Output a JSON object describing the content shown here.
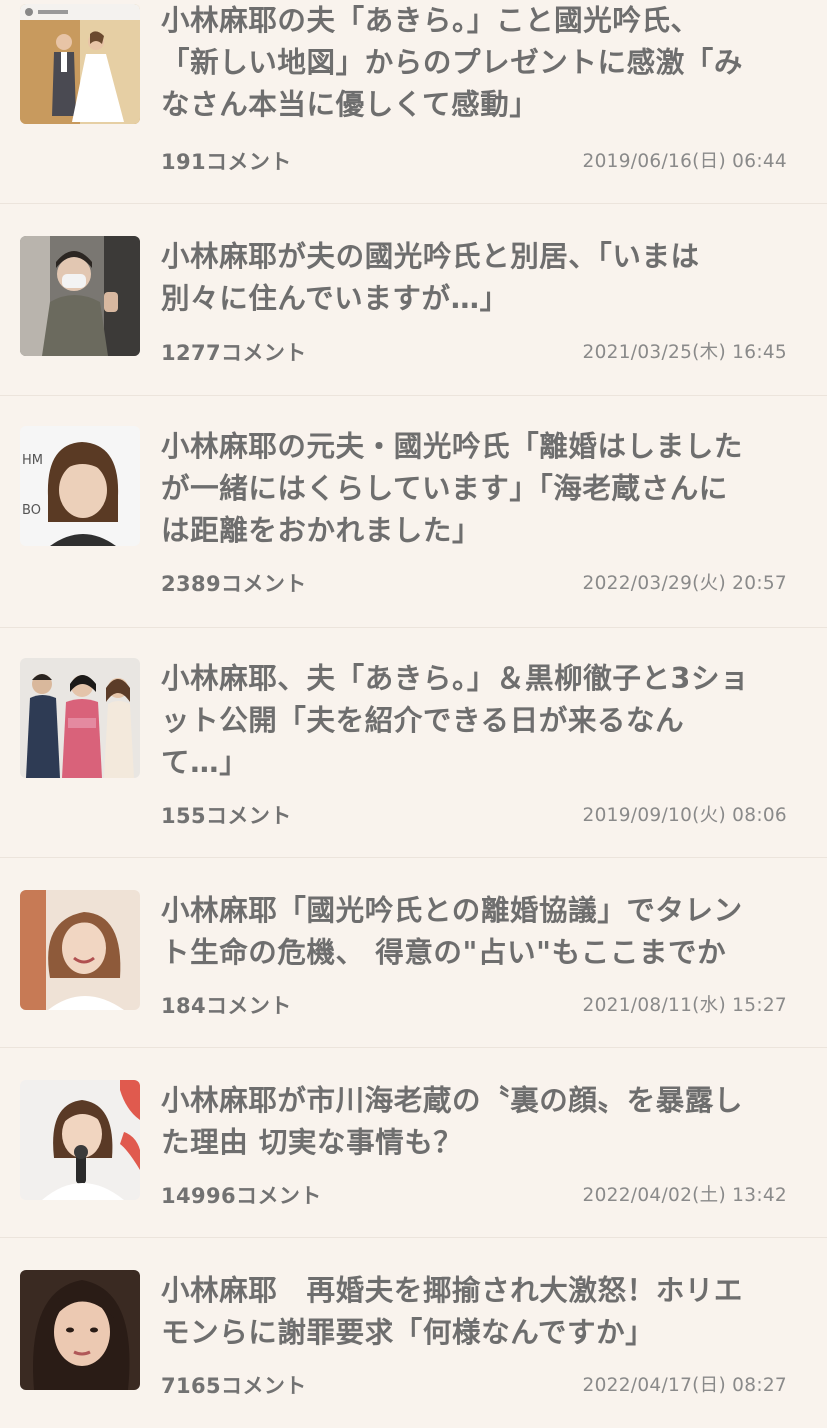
{
  "articles": [
    {
      "title": "小林麻耶の夫「あきら。」こと國光吟氏、\n「新しい地図」からのプレゼントに感激「み\nなさん本当に優しくて感動」",
      "comments": "191コメント",
      "date": "2019/06/16(日) 06:44",
      "thumb_icon": "wedding-photo"
    },
    {
      "title": "小林麻耶が夫の國光吟氏と別居、「いまは\n別々に住んでいますが…」",
      "comments": "1277コメント",
      "date": "2021/03/25(木) 16:45",
      "thumb_icon": "masked-woman-photo"
    },
    {
      "title": "小林麻耶の元夫・國光吟氏「離婚はしました\nが一緒にはくらしています」「海老蔵さんに\nは距離をおかれました」",
      "comments": "2389コメント",
      "date": "2022/03/29(火) 20:57",
      "thumb_icon": "woman-portrait-photo"
    },
    {
      "title": "小林麻耶、夫「あきら。」＆黒柳徹子と3ショ\nット公開「夫を紹介できる日が来るなん\nて…」",
      "comments": "155コメント",
      "date": "2019/09/10(火) 08:06",
      "thumb_icon": "group-photo"
    },
    {
      "title": "小林麻耶「國光吟氏との離婚協議」でタレン\nト生命の危機、 得意の\"占い\"もここまでか",
      "comments": "184コメント",
      "date": "2021/08/11(水) 15:27",
      "thumb_icon": "smiling-woman-photo"
    },
    {
      "title": "小林麻耶が市川海老蔵の〝裏の顔〟を暴露し\nた理由 切実な事情も？",
      "comments": "14996コメント",
      "date": "2022/04/02(土) 13:42",
      "thumb_icon": "woman-microphone-photo"
    },
    {
      "title": "小林麻耶　再婚夫を揶揄され大激怒！ホリエ\nモンらに謝罪要求「何様なんですか」",
      "comments": "7165コメント",
      "date": "2022/04/17(日) 08:27",
      "thumb_icon": "woman-closeup-photo"
    }
  ]
}
